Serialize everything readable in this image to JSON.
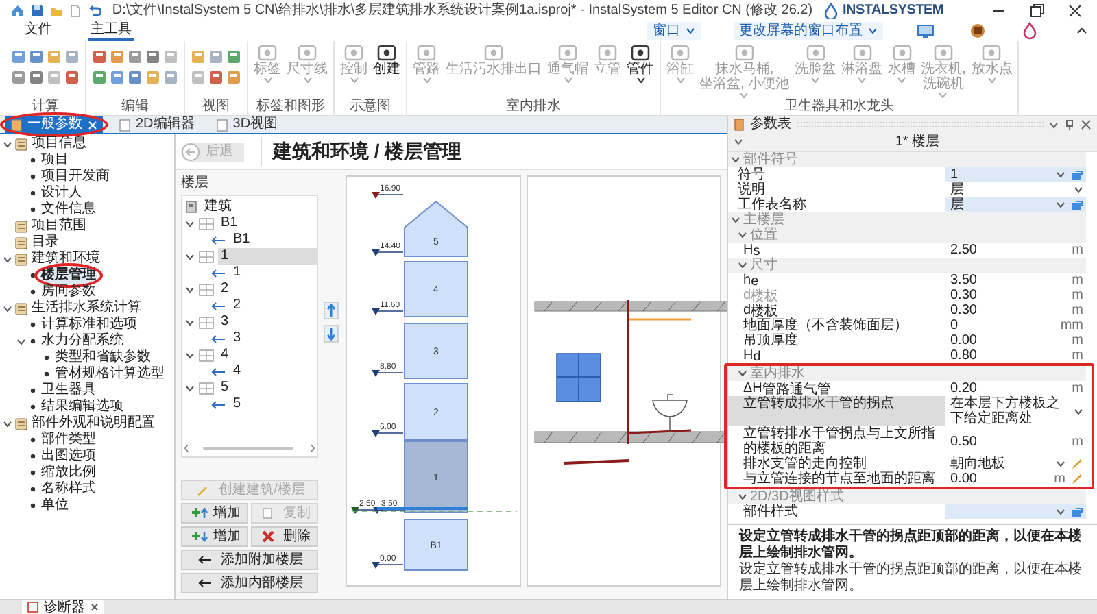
{
  "title_bar": {
    "title": "D:\\文件\\InstalSystem 5 CN\\给排水\\排水\\多层建筑排水系统设计案例1a.isproj* - InstalSystem 5 Editor CN (修改 26.2)",
    "logo": "INSTALSYSTEM"
  },
  "menu": [
    {
      "label": "文件",
      "selected": false
    },
    {
      "label": "主工具",
      "selected": true
    }
  ],
  "window_menu": [
    {
      "label": "窗口"
    },
    {
      "label": "更改屏幕的窗口布置"
    }
  ],
  "ribbon": [
    {
      "label": "计算",
      "kind": "icons"
    },
    {
      "label": "编辑",
      "kind": "icons"
    },
    {
      "label": "视图",
      "kind": "icons"
    },
    {
      "label": "标签和图形",
      "kind": "tools",
      "tools": [
        {
          "label": "标签",
          "dropdown": true,
          "disabled": true
        },
        {
          "label": "尺寸线",
          "dropdown": true,
          "disabled": true
        }
      ]
    },
    {
      "label": "示意图",
      "kind": "tools",
      "tools": [
        {
          "label": "控制",
          "dropdown": true,
          "disabled": true
        },
        {
          "label": "创建",
          "dropdown": false,
          "disabled": false
        }
      ]
    },
    {
      "label": "室内排水",
      "kind": "tools",
      "tools": [
        {
          "label": "管路",
          "dropdown": true,
          "disabled": true
        },
        {
          "label": "生活污水排出口",
          "dropdown": false,
          "disabled": true
        },
        {
          "label": "通气帽",
          "dropdown": true,
          "disabled": true
        },
        {
          "label": "立管",
          "dropdown": false,
          "disabled": true
        },
        {
          "label": "管件",
          "dropdown": true,
          "disabled": false
        }
      ]
    },
    {
      "label": "卫生器具和水龙头",
      "kind": "tools",
      "tools": [
        {
          "label": "浴缸",
          "dropdown": true,
          "disabled": true
        },
        {
          "label": "抹水马桶,\n坐浴盆, 小便池",
          "dropdown": true,
          "disabled": true
        },
        {
          "label": "洗脸盆",
          "dropdown": true,
          "disabled": true
        },
        {
          "label": "淋浴盘",
          "dropdown": true,
          "disabled": true
        },
        {
          "label": "水槽",
          "dropdown": true,
          "disabled": true
        },
        {
          "label": "洗衣机,\n洗碗机",
          "dropdown": true,
          "disabled": true
        },
        {
          "label": "放水点",
          "dropdown": true,
          "disabled": true
        }
      ]
    }
  ],
  "doc_tabs": [
    {
      "label": "一般参数",
      "selected": true,
      "annotated": true
    },
    {
      "label": "2D编辑器",
      "selected": false,
      "annotated": false
    },
    {
      "label": "3D视图",
      "selected": false,
      "annotated": false
    }
  ],
  "tree": [
    {
      "label": "项目信息",
      "selected": false,
      "annotated": false,
      "expanded": true,
      "children": [
        {
          "label": "项目",
          "selected": false,
          "annotated": false
        },
        {
          "label": "项目开发商",
          "selected": false,
          "annotated": false
        },
        {
          "label": "设计人",
          "selected": false,
          "annotated": false
        },
        {
          "label": "文件信息",
          "selected": false,
          "annotated": false
        }
      ]
    },
    {
      "label": "项目范围",
      "selected": false,
      "annotated": false
    },
    {
      "label": "目录",
      "selected": false,
      "annotated": false
    },
    {
      "label": "建筑和环境",
      "selected": false,
      "annotated": false,
      "expanded": true,
      "children": [
        {
          "label": "楼层管理",
          "selected": true,
          "annotated": true
        },
        {
          "label": "房间参数",
          "selected": false,
          "annotated": false
        }
      ]
    },
    {
      "label": "生活排水系统计算",
      "selected": false,
      "annotated": false,
      "expanded": true,
      "children": [
        {
          "label": "计算标准和选项",
          "selected": false,
          "annotated": false
        },
        {
          "label": "水力分配系统",
          "selected": false,
          "annotated": false,
          "expanded": true,
          "children": [
            {
              "label": "类型和省缺参数",
              "selected": false,
              "annotated": false
            },
            {
              "label": "管材规格计算选型",
              "selected": false,
              "annotated": false
            }
          ]
        },
        {
          "label": "卫生器具",
          "selected": false,
          "annotated": false
        },
        {
          "label": "结果编辑选项",
          "selected": false,
          "annotated": false
        }
      ]
    },
    {
      "label": "部件外观和说明配置",
      "selected": false,
      "annotated": false,
      "expanded": true,
      "children": [
        {
          "label": "部件类型",
          "selected": false,
          "annotated": false
        },
        {
          "label": "出图选项",
          "selected": false,
          "annotated": false
        },
        {
          "label": "缩放比例",
          "selected": false,
          "annotated": false
        },
        {
          "label": "名称样式",
          "selected": false,
          "annotated": false
        },
        {
          "label": "单位",
          "selected": false,
          "annotated": false
        }
      ]
    }
  ],
  "page_header": {
    "back_button": {
      "label": "后退",
      "disabled": true
    },
    "title": "建筑和环境 / 楼层管理"
  },
  "floor_list": {
    "label": "楼层",
    "items": [
      {
        "label": "建筑",
        "kind": "building",
        "selected": false
      },
      {
        "label": "B1",
        "kind": "floor",
        "selected": false,
        "expanded": true,
        "children": [
          {
            "label": "B1",
            "kind": "level",
            "selected": false
          }
        ]
      },
      {
        "label": "1",
        "kind": "floor",
        "selected": true,
        "expanded": true,
        "children": [
          {
            "label": "1",
            "kind": "level",
            "selected": false
          }
        ]
      },
      {
        "label": "2",
        "kind": "floor",
        "selected": false,
        "expanded": true,
        "children": [
          {
            "label": "2",
            "kind": "level",
            "selected": false
          }
        ]
      },
      {
        "label": "3",
        "kind": "floor",
        "selected": false,
        "expanded": true,
        "children": [
          {
            "label": "3",
            "kind": "level",
            "selected": false
          }
        ]
      },
      {
        "label": "4",
        "kind": "floor",
        "selected": false,
        "expanded": true,
        "children": [
          {
            "label": "4",
            "kind": "level",
            "selected": false
          }
        ]
      },
      {
        "label": "5",
        "kind": "floor",
        "selected": false,
        "expanded": true,
        "children": [
          {
            "label": "5",
            "kind": "level",
            "selected": false
          }
        ]
      }
    ]
  },
  "floor_buttons": [
    {
      "label": "创建建筑/楼层",
      "kind": "create",
      "disabled": true
    },
    {
      "label": "增加",
      "kind": "add_above",
      "disabled": false
    },
    {
      "label": "复制",
      "kind": "copy",
      "disabled": true
    },
    {
      "label": "增加",
      "kind": "add_below",
      "disabled": false
    },
    {
      "label": "删除",
      "kind": "delete",
      "disabled": false
    },
    {
      "label": "添加附加楼层",
      "kind": "add_attached",
      "disabled": false
    },
    {
      "label": "添加内部楼层",
      "kind": "add_inner",
      "disabled": false
    }
  ],
  "building": {
    "floors": [
      {
        "label": "5",
        "selected": false
      },
      {
        "label": "4",
        "selected": false
      },
      {
        "label": "3",
        "selected": false
      },
      {
        "label": "2",
        "selected": false
      },
      {
        "label": "1",
        "selected": true
      },
      {
        "label": "B1",
        "selected": false
      }
    ],
    "elevations": [
      "16.90",
      "14.40",
      "11.60",
      "8.80",
      "6.00",
      "2.50",
      "3.50",
      "0.00"
    ]
  },
  "properties": {
    "title": "参数表",
    "header": "1* 楼层",
    "items": [
      {
        "kind": "group",
        "label": "部件符号",
        "expanded": true,
        "annotated": false,
        "children": [
          {
            "kind": "row",
            "name": "符号",
            "value": "1",
            "selected": false,
            "dim": false,
            "dropdown": true,
            "linked": true,
            "edit": false
          },
          {
            "kind": "row",
            "name": "说明",
            "value": "层",
            "selected": false,
            "dim": false,
            "dropdown": true,
            "linked": false,
            "edit": false
          },
          {
            "kind": "row",
            "name": "工作表名称",
            "value": "层",
            "selected": false,
            "dim": false,
            "dropdown": true,
            "linked": true,
            "edit": false
          }
        ]
      },
      {
        "kind": "group",
        "label": "主楼层",
        "expanded": true,
        "annotated": false,
        "children": [
          {
            "kind": "group",
            "label": "位置",
            "expanded": true,
            "annotated": false,
            "children": [
              {
                "kind": "row",
                "name": "H$_{s}$",
                "value": "2.50",
                "unit": "m",
                "selected": false,
                "dim": false,
                "dropdown": false,
                "linked": false,
                "edit": false
              }
            ]
          },
          {
            "kind": "group",
            "label": "尺寸",
            "expanded": true,
            "annotated": false,
            "children": [
              {
                "kind": "row",
                "name": "h$_{e}$",
                "value": "3.50",
                "unit": "m",
                "selected": false,
                "dim": false,
                "dropdown": false,
                "linked": false,
                "edit": false
              },
              {
                "kind": "row",
                "name": "d$_{楼板}$",
                "value": "0.30",
                "unit": "m",
                "selected": false,
                "dim": true,
                "dropdown": false,
                "linked": false,
                "edit": false
              },
              {
                "kind": "row",
                "name": "d$_{楼板}$",
                "value": "0.30",
                "unit": "m",
                "selected": false,
                "dim": false,
                "dropdown": false,
                "linked": false,
                "edit": false
              },
              {
                "kind": "row",
                "name": "地面厚度（不含装饰面层）",
                "value": "0",
                "unit": "mm",
                "selected": false,
                "dim": false,
                "dropdown": false,
                "linked": false,
                "edit": false
              },
              {
                "kind": "row",
                "name": "吊顶厚度",
                "value": "0.00",
                "unit": "m",
                "selected": false,
                "dim": false,
                "dropdown": false,
                "linked": false,
                "edit": false
              },
              {
                "kind": "row",
                "name": "H$_{d}$",
                "value": "0.80",
                "unit": "m",
                "selected": false,
                "dim": false,
                "dropdown": false,
                "linked": false,
                "edit": false
              }
            ]
          },
          {
            "kind": "group",
            "label": "室内排水",
            "expanded": true,
            "annotated": true,
            "children": [
              {
                "kind": "row",
                "name": "ΔH$_{管路通气管}$",
                "value": "0.20",
                "unit": "m",
                "selected": false,
                "dim": false,
                "dropdown": false,
                "linked": false,
                "edit": false
              },
              {
                "kind": "row",
                "name": "立管转成排水干管的拐点",
                "value": "在本层下方楼板之下给定距离处",
                "selected": true,
                "dim": false,
                "dropdown": true,
                "linked": false,
                "edit": false
              },
              {
                "kind": "row",
                "name": "立管转排水干管拐点与上文所指的楼板的距离",
                "value": "0.50",
                "unit": "m",
                "selected": false,
                "dim": false,
                "dropdown": false,
                "linked": false,
                "edit": false
              },
              {
                "kind": "row",
                "name": "排水支管的走向控制",
                "value": "朝向地板",
                "selected": false,
                "dim": false,
                "dropdown": true,
                "linked": false,
                "edit": true
              },
              {
                "kind": "row",
                "name": "与立管连接的节点至地面的距离",
                "value": "0.00",
                "unit": "m",
                "selected": false,
                "dim": false,
                "dropdown": false,
                "linked": false,
                "edit": true
              }
            ]
          },
          {
            "kind": "group",
            "label": "2D/3D视图样式",
            "expanded": true,
            "annotated": false,
            "children": [
              {
                "kind": "row",
                "name": "部件样式",
                "selected": false,
                "dim": false,
                "dropdown": true,
                "linked": true,
                "edit": false
              }
            ]
          }
        ]
      }
    ]
  },
  "description": {
    "title": "设定立管转成排水干管的拐点距顶部的距离，以便在本楼层上绘制排水管网。",
    "text": "设定立管转成排水干管的拐点距顶部的距离，以便在本楼层上绘制排水管网。"
  },
  "status_bar": {
    "tabs": [
      {
        "label": "诊断器"
      }
    ]
  }
}
